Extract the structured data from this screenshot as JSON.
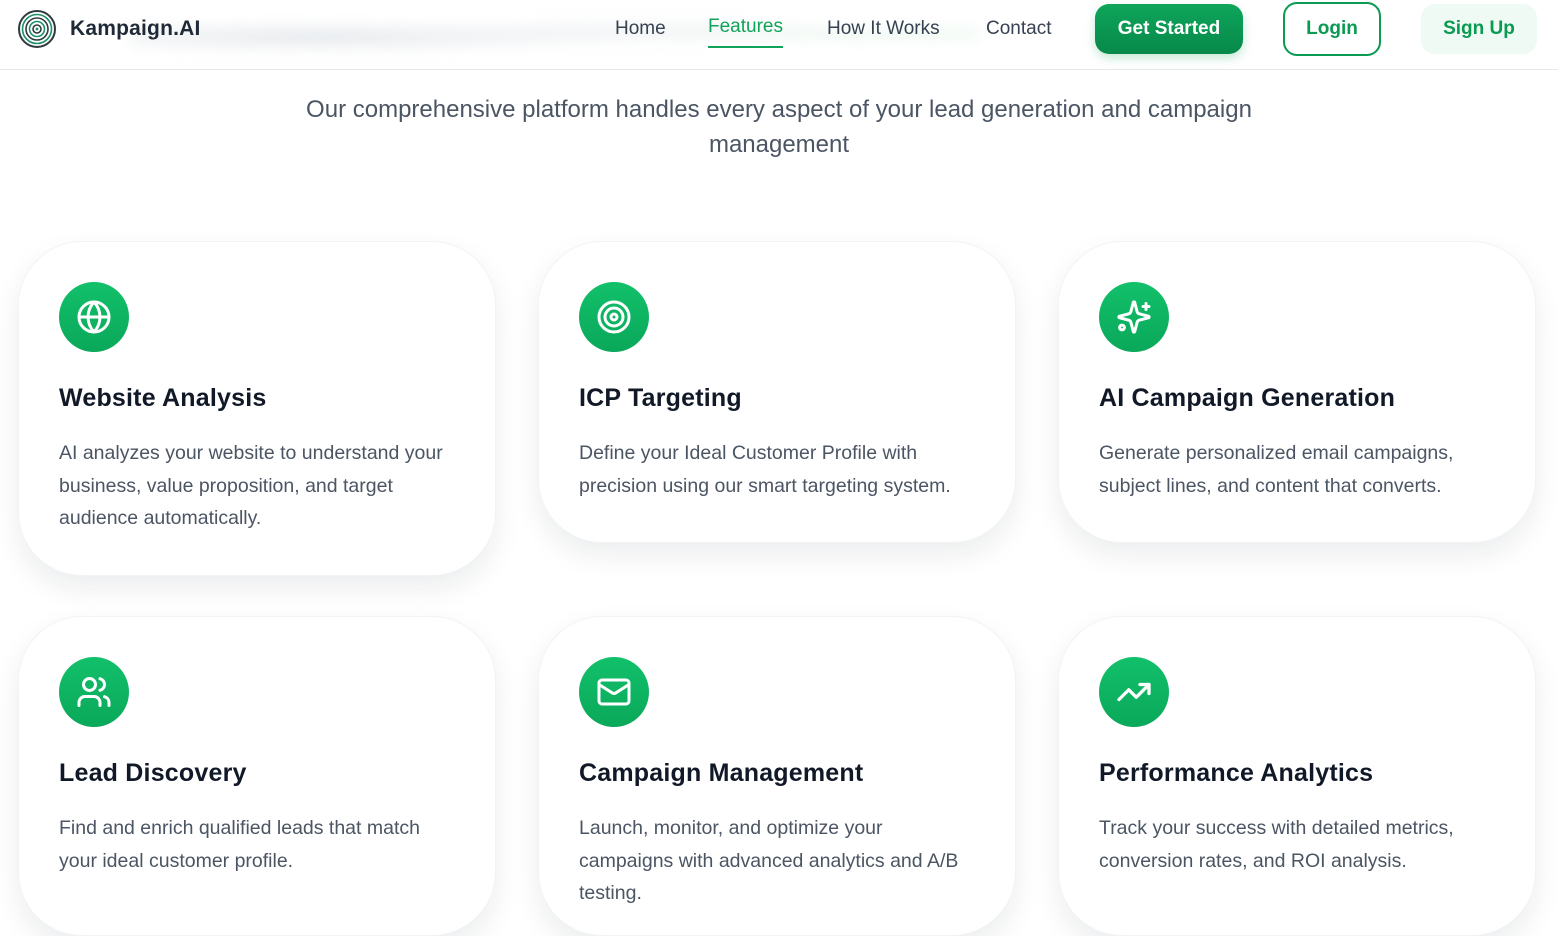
{
  "header": {
    "brand_name": "Kampaign.AI",
    "nav": {
      "home": "Home",
      "features": "Features",
      "how_it_works": "How It Works",
      "contact": "Contact"
    },
    "get_started": "Get Started",
    "login": "Login",
    "sign_up": "Sign Up"
  },
  "section": {
    "subtitle": "Our comprehensive platform handles every aspect of your lead generation and campaign management"
  },
  "features": [
    {
      "icon": "globe-icon",
      "title": "Website Analysis",
      "description": "AI analyzes your website to understand your business, value proposition, and target audience automatically."
    },
    {
      "icon": "target-icon",
      "title": "ICP Targeting",
      "description": "Define your Ideal Customer Profile with precision using our smart targeting system."
    },
    {
      "icon": "sparkles-icon",
      "title": "AI Campaign Generation",
      "description": "Generate personalized email campaigns, subject lines, and content that converts."
    },
    {
      "icon": "users-icon",
      "title": "Lead Discovery",
      "description": "Find and enrich qualified leads that match your ideal customer profile."
    },
    {
      "icon": "mail-icon",
      "title": "Campaign Management",
      "description": "Launch, monitor, and optimize your campaigns with advanced analytics and A/B testing."
    },
    {
      "icon": "trending-up-icon",
      "title": "Performance Analytics",
      "description": "Track your success with detailed metrics, conversion rates, and ROI analysis."
    }
  ],
  "colors": {
    "accent": "#0ea55a",
    "accent_light": "#eefaf3",
    "text_dark": "#111827",
    "text_muted": "#4b5563"
  }
}
